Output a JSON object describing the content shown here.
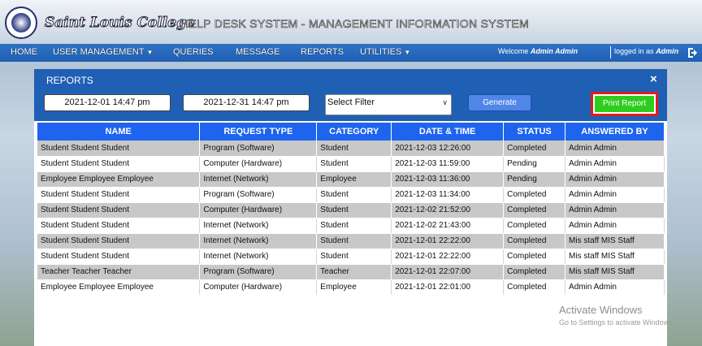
{
  "header": {
    "college_name": "Saint Louis College",
    "system_title": "HELP DESK SYSTEM - MANAGEMENT INFORMATION SYSTEM"
  },
  "nav": {
    "items": [
      {
        "label": "HOME"
      },
      {
        "label": "USER MANAGEMENT",
        "dropdown": true
      },
      {
        "label": "QUERIES"
      },
      {
        "label": "MESSAGE"
      },
      {
        "label": "REPORTS"
      },
      {
        "label": "UTILITIES",
        "dropdown": true
      }
    ],
    "welcome_prefix": "Welcome",
    "welcome_user": "Admin Admin",
    "logged_prefix": "logged in as",
    "logged_user": "Admin",
    "logout_icon": "logout-icon"
  },
  "modal": {
    "title": "REPORTS",
    "close_label": "×",
    "date_from": "2021-12-01 14:47 pm",
    "date_to": "2021-12-31 14:47 pm",
    "filter_selected": "Select Filter",
    "generate_label": "Generate",
    "print_label": "Print Report"
  },
  "table": {
    "headers": [
      "NAME",
      "REQUEST TYPE",
      "CATEGORY",
      "DATE & TIME",
      "STATUS",
      "ANSWERED BY"
    ],
    "rows": [
      [
        "Student Student Student",
        "Program (Software)",
        "Student",
        "2021-12-03 12:26:00",
        "Completed",
        "Admin Admin"
      ],
      [
        "Student Student Student",
        "Computer (Hardware)",
        "Student",
        "2021-12-03 11:59:00",
        "Pending",
        "Admin Admin"
      ],
      [
        "Employee Employee Employee",
        "Internet (Network)",
        "Employee",
        "2021-12-03 11:36:00",
        "Pending",
        "Admin Admin"
      ],
      [
        "Student Student Student",
        "Program (Software)",
        "Student",
        "2021-12-03 11:34:00",
        "Completed",
        "Admin Admin"
      ],
      [
        "Student Student Student",
        "Computer (Hardware)",
        "Student",
        "2021-12-02 21:52:00",
        "Completed",
        "Admin Admin"
      ],
      [
        "Student Student Student",
        "Internet (Network)",
        "Student",
        "2021-12-02 21:43:00",
        "Completed",
        "Admin Admin"
      ],
      [
        "Student Student Student",
        "Internet (Network)",
        "Student",
        "2021-12-01 22:22:00",
        "Completed",
        "Mis staff MIS Staff"
      ],
      [
        "Student Student Student",
        "Internet (Network)",
        "Student",
        "2021-12-01 22:22:00",
        "Completed",
        "Mis staff MIS Staff"
      ],
      [
        "Teacher Teacher Teacher",
        "Program (Software)",
        "Teacher",
        "2021-12-01 22:07:00",
        "Completed",
        "Mis staff MIS Staff"
      ],
      [
        "Employee Employee Employee",
        "Computer (Hardware)",
        "Employee",
        "2021-12-01 22:01:00",
        "Completed",
        "Admin Admin"
      ]
    ]
  },
  "watermark": {
    "line1": "Activate Windows",
    "line2": "Go to Settings to activate Windows."
  }
}
